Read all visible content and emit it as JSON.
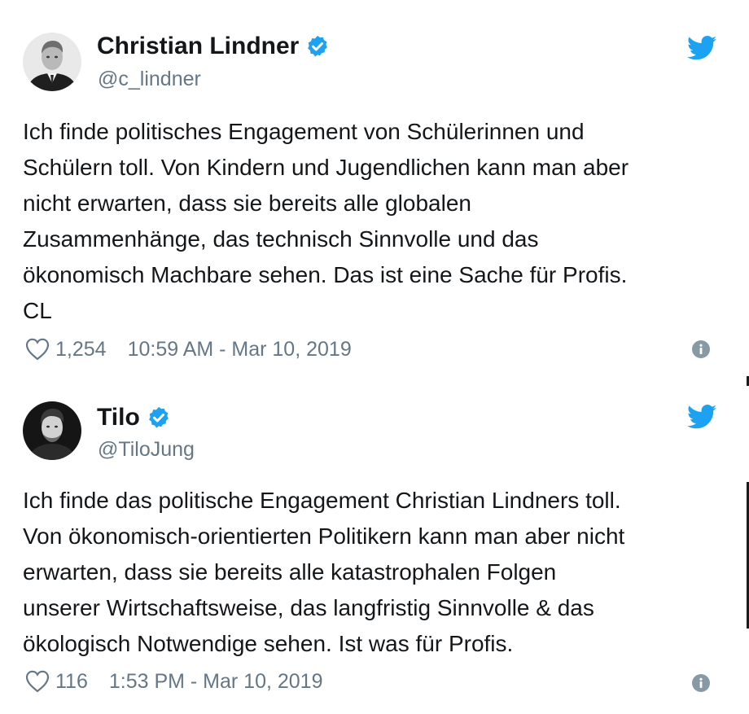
{
  "tweets": [
    {
      "display_name": "Christian Lindner",
      "handle": "@c_lindner",
      "verified": true,
      "text": "Ich finde politisches Engagement von Schülerinnen und\nSchülern toll. Von Kindern und Jugendlichen kann man aber\nnicht erwarten, dass sie bereits alle globalen\nZusammenhänge, das technisch Sinnvolle und das\nökonomisch Machbare sehen. Das ist eine Sache für Profis.\nCL",
      "likes": "1,254",
      "timestamp": "10:59 AM - Mar 10, 2019"
    },
    {
      "display_name": "Tilo",
      "handle": "@TiloJung",
      "verified": true,
      "text": "Ich finde das politische Engagement Christian Lindners toll.\nVon ökonomisch-orientierten Politikern kann man aber nicht\nerwarten, dass sie bereits alle katastrophalen Folgen\nunserer Wirtschaftsweise, das langfristig Sinnvolle & das\nökologisch Notwendige sehen. Ist was für Profis.",
      "likes": "116",
      "timestamp": "1:53 PM - Mar 10, 2019"
    }
  ],
  "icons": {
    "verified": "verified-badge-icon",
    "brand": "twitter-bird-icon",
    "like": "heart-icon",
    "info": "info-icon"
  },
  "colors": {
    "twitter_blue": "#1da1f2",
    "text": "#14171a",
    "secondary": "#657786"
  }
}
